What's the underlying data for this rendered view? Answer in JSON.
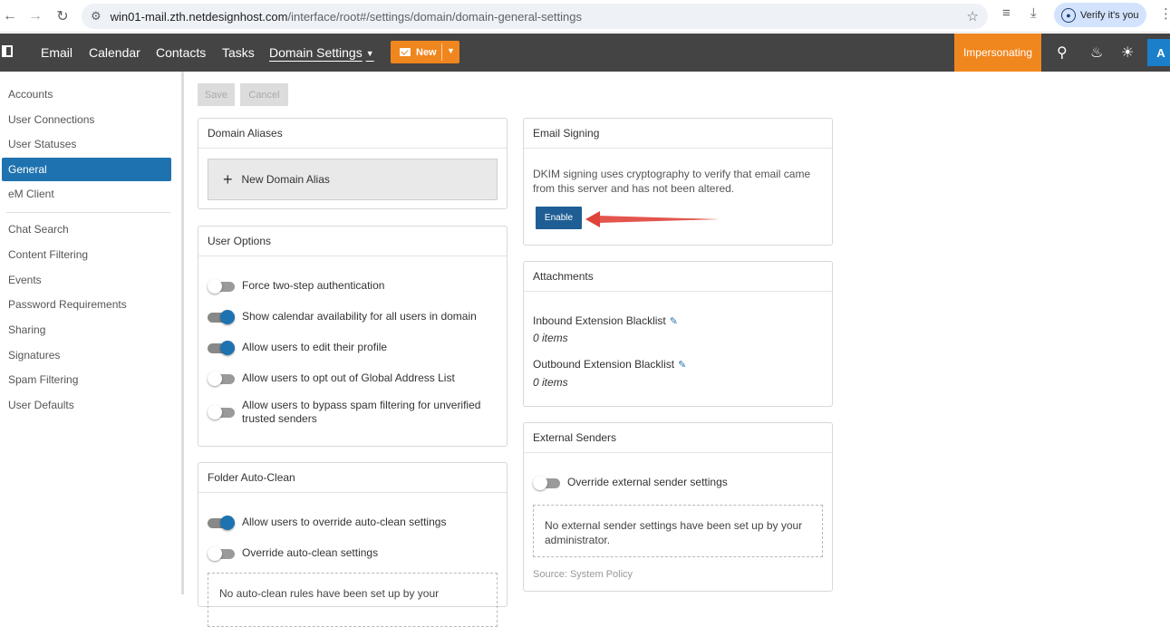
{
  "browser": {
    "url_host": "win01-mail.zth.netdesignhost.com",
    "url_path": "/interface/root#/settings/domain/domain-general-settings",
    "verify_label": "Verify it's you"
  },
  "nav": {
    "email": "Email",
    "calendar": "Calendar",
    "contacts": "Contacts",
    "tasks": "Tasks",
    "domain_settings": "Domain Settings",
    "new_label": "New",
    "impersonating": "Impersonating",
    "avatar_letter": "A"
  },
  "sidebar": {
    "items": [
      {
        "label": "Accounts"
      },
      {
        "label": "User Connections"
      },
      {
        "label": "User Statuses"
      },
      {
        "label": "General"
      },
      {
        "label": "eM Client"
      },
      {
        "label": "Chat Search"
      },
      {
        "label": "Content Filtering"
      },
      {
        "label": "Events"
      },
      {
        "label": "Password Requirements"
      },
      {
        "label": "Sharing"
      },
      {
        "label": "Signatures"
      },
      {
        "label": "Spam Filtering"
      },
      {
        "label": "User Defaults"
      }
    ]
  },
  "toolbar": {
    "save": "Save",
    "cancel": "Cancel"
  },
  "domain_aliases": {
    "title": "Domain Aliases",
    "new_alias": "New Domain Alias"
  },
  "user_options": {
    "title": "User Options",
    "options": [
      {
        "label": "Force two-step authentication",
        "state": "off"
      },
      {
        "label": "Show calendar availability for all users in domain",
        "state": "on"
      },
      {
        "label": "Allow users to edit their profile",
        "state": "on"
      },
      {
        "label": "Allow users to opt out of Global Address List",
        "state": "off"
      },
      {
        "label": "Allow users to bypass spam filtering for unverified trusted senders",
        "state": "off"
      }
    ]
  },
  "folder_auto_clean": {
    "title": "Folder Auto-Clean",
    "options": [
      {
        "label": "Allow users to override auto-clean settings",
        "state": "on"
      },
      {
        "label": "Override auto-clean settings",
        "state": "off"
      }
    ],
    "empty_text": "No auto-clean rules have been set up by your"
  },
  "email_signing": {
    "title": "Email Signing",
    "description": "DKIM signing uses cryptography to verify that email came from this server and has not been altered.",
    "enable": "Enable"
  },
  "attachments": {
    "title": "Attachments",
    "inbound_label": "Inbound Extension Blacklist",
    "inbound_value": "0 items",
    "outbound_label": "Outbound Extension Blacklist",
    "outbound_value": "0 items"
  },
  "external_senders": {
    "title": "External Senders",
    "override_label": "Override external sender settings",
    "override_state": "off",
    "empty_text": "No external sender settings have been set up by your administrator.",
    "source": "Source: System Policy"
  },
  "colors": {
    "accent_orange": "#f0861e",
    "active_blue": "#1f72b0",
    "nav_dark": "#444444",
    "arrow_red": "#e0433a"
  }
}
